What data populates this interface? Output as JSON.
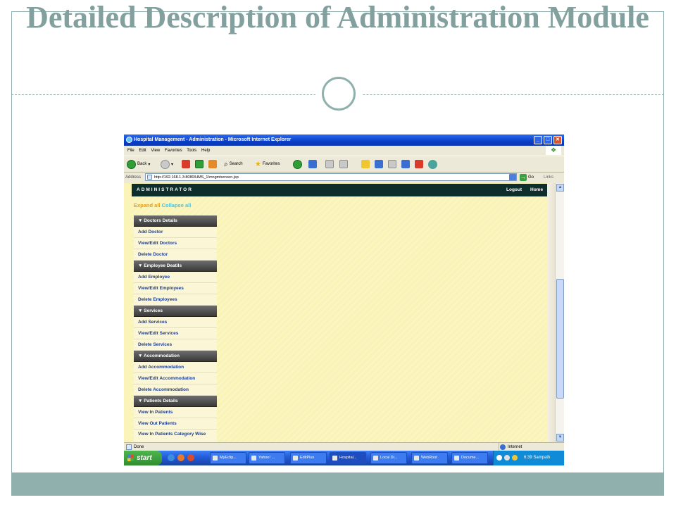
{
  "slide": {
    "title": "Detailed Description of Administration Module"
  },
  "window": {
    "title": "Hospital Management - Administration - Microsoft Internet Explorer",
    "menu": [
      "File",
      "Edit",
      "View",
      "Favorites",
      "Tools",
      "Help"
    ],
    "toolbar": {
      "back": "Back",
      "search": "Search",
      "favorites": "Favorites"
    },
    "address_label": "Address",
    "url": "http://192.168.1.3:8080/HMS_1/mngmtscreen.jsp",
    "go": "Go",
    "links": "Links",
    "status": "Done",
    "zone": "Internet"
  },
  "page": {
    "brand": "ADMINISTRATOR",
    "logout": "Logout",
    "home": "Home",
    "expand_all": "Expand all",
    "collapse_all": "Collapse all",
    "sections": [
      {
        "title": "▼ Doctors Details",
        "items": [
          "Add Doctor",
          "View/Edit Doctors",
          "Delete Doctor"
        ]
      },
      {
        "title": "▼ Employee Deatils",
        "items": [
          "Add Employee",
          "View/Edit Employees",
          "Delete Employees"
        ]
      },
      {
        "title": "▼ Services",
        "items": [
          "Add Services",
          "View/Edit Services",
          "Delete Services"
        ]
      },
      {
        "title": "▼ Accommodation",
        "items": [
          "Add Accommodation",
          "View/Edit Accommodation",
          "Delete Accommodation"
        ]
      },
      {
        "title": "▼ Patients Details",
        "items": [
          "View In Patients",
          "View Out Patients",
          "View In Patients Category Wise"
        ]
      }
    ]
  },
  "taskbar": {
    "start": "start",
    "tasks": [
      "MyEclip...",
      "Yahoo! ...",
      "EditPlus",
      "Hospital...",
      "Local Di...",
      "WebRoot",
      "Docume..."
    ],
    "clock": "6:39 Sampath"
  },
  "colors": {
    "slide_accent": "#8fb0ad",
    "page_bg": "#fbf4b8",
    "header_bg": "#0e2e2c",
    "link_color": "#1f3d8c",
    "expand_color": "#e0a020",
    "collapse_color": "#4fc3d8"
  }
}
